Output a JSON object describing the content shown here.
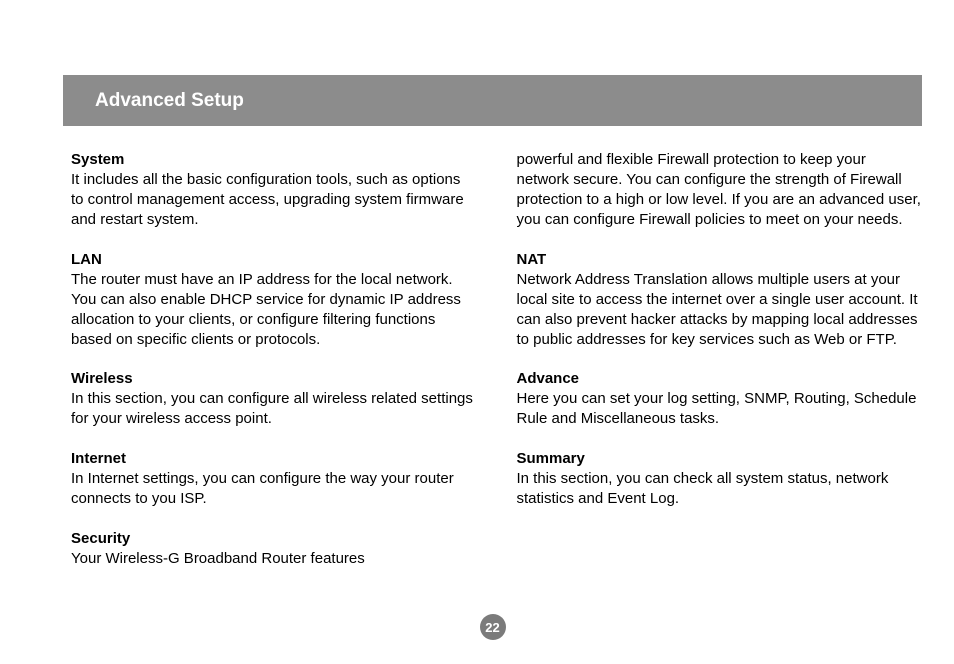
{
  "header": {
    "title": "Advanced Setup"
  },
  "left_column": {
    "sections": [
      {
        "heading": "System",
        "body": "It includes all the basic configuration tools, such as options to control management access, upgrading system firmware and restart system."
      },
      {
        "heading": "LAN",
        "body": "The router must have an IP address for the local network. You can also enable DHCP service for dynamic IP address allocation to your clients, or configure filtering functions based on specific clients or protocols."
      },
      {
        "heading": "Wireless",
        "body": "In this section, you can configure all wireless related settings for your wireless access point."
      },
      {
        "heading": "Internet",
        "body": "In Internet settings, you can configure the way your router connects to you ISP."
      },
      {
        "heading": "Security",
        "body": "Your Wireless-G Broadband Router features"
      }
    ]
  },
  "right_column": {
    "continuation": "powerful and flexible Firewall protection to keep your network secure. You can configure the strength of Firewall protection to a high or low level. If you are an advanced user, you can configure Firewall policies to meet on your needs.",
    "sections": [
      {
        "heading": "NAT",
        "body": "Network Address Translation allows multiple users at your local site to access the internet over a single user account. It can also prevent hacker attacks by mapping local addresses to public addresses for key services such as Web or FTP."
      },
      {
        "heading": "Advance",
        "body": "Here you can set your log setting, SNMP, Routing, Schedule Rule and Miscellaneous tasks."
      },
      {
        "heading": "Summary",
        "body": "In this section, you can check all system status, network statistics and Event Log."
      }
    ]
  },
  "page_number": "22"
}
